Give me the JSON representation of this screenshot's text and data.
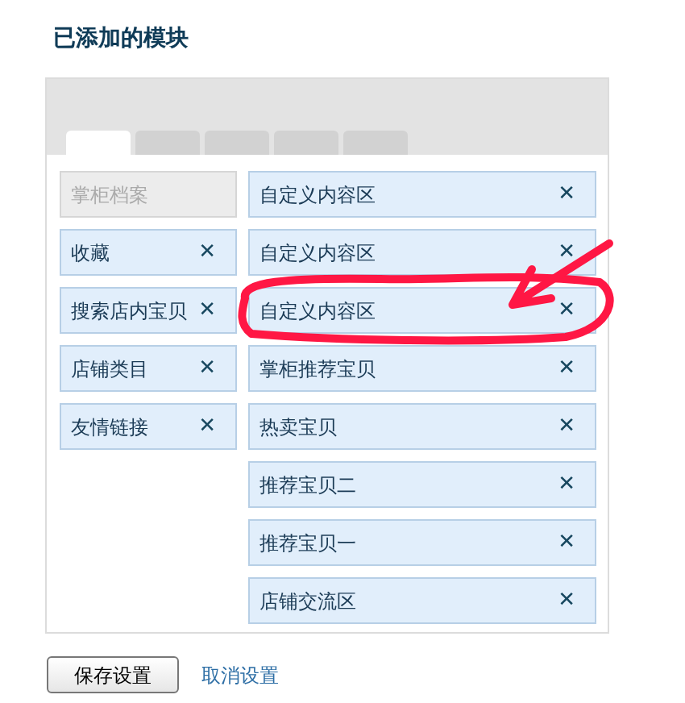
{
  "title": "已添加的模块",
  "tabs": [
    {
      "selected": true
    },
    {
      "selected": false
    },
    {
      "selected": false
    },
    {
      "selected": false
    },
    {
      "selected": false
    }
  ],
  "left_modules": [
    {
      "label": "掌柜档案",
      "removable": false
    },
    {
      "label": "收藏",
      "removable": true,
      "remove": "✕"
    },
    {
      "label": "搜索店内宝贝",
      "removable": true,
      "remove": "✕"
    },
    {
      "label": "店铺类目",
      "removable": true,
      "remove": "✕"
    },
    {
      "label": "友情链接",
      "removable": true,
      "remove": "✕"
    }
  ],
  "right_modules": [
    {
      "label": "自定义内容区",
      "remove": "✕",
      "highlighted": false
    },
    {
      "label": "自定义内容区",
      "remove": "✕",
      "highlighted": false
    },
    {
      "label": "自定义内容区",
      "remove": "✕",
      "highlighted": true
    },
    {
      "label": "掌柜推荐宝贝",
      "remove": "✕",
      "highlighted": false
    },
    {
      "label": "热卖宝贝",
      "remove": "✕",
      "highlighted": false
    },
    {
      "label": "推荐宝贝二",
      "remove": "✕",
      "highlighted": false
    },
    {
      "label": "推荐宝贝一",
      "remove": "✕",
      "highlighted": false
    },
    {
      "label": "店铺交流区",
      "remove": "✕",
      "highlighted": false
    }
  ],
  "save_button": "保存设置",
  "cancel_link": "取消设置"
}
